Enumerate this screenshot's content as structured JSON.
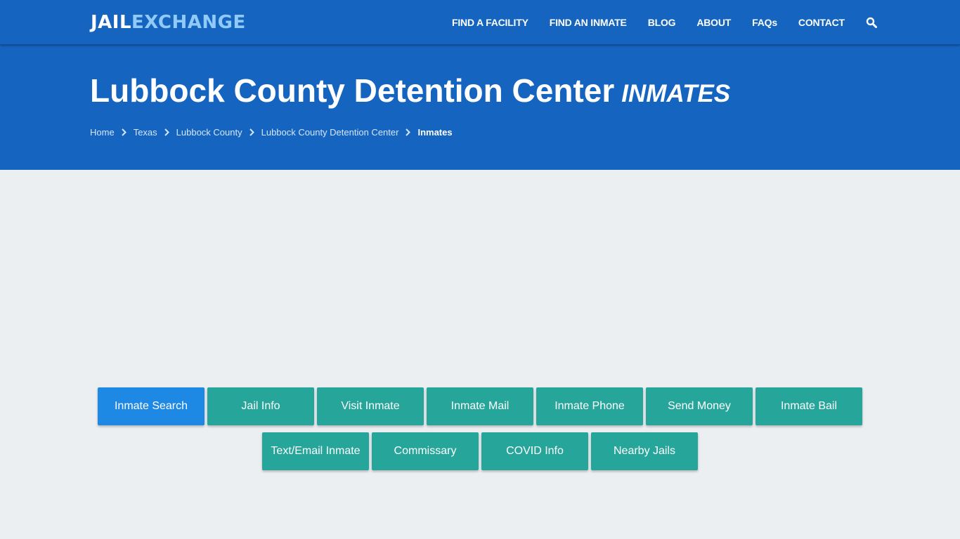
{
  "brand": {
    "logo_part1": "JAIL",
    "logo_part2": "EXCHANGE",
    "colors": {
      "primary": "#1565c0",
      "logo_accent": "#90caf9",
      "button_teal": "#26a69a",
      "button_active": "#1e88e5",
      "page_bg": "#eceff2"
    }
  },
  "nav": {
    "items": [
      {
        "label": "FIND A FACILITY"
      },
      {
        "label": "FIND AN INMATE"
      },
      {
        "label": "BLOG"
      },
      {
        "label": "ABOUT"
      },
      {
        "label": "FAQs"
      },
      {
        "label": "CONTACT"
      }
    ],
    "search_icon": "search-icon"
  },
  "hero": {
    "title": "Lubbock County Detention Center",
    "title_suffix": "INMATES",
    "breadcrumb": [
      {
        "label": "Home"
      },
      {
        "label": "Texas"
      },
      {
        "label": "Lubbock County"
      },
      {
        "label": "Lubbock County Detention Center"
      },
      {
        "label": "Inmates"
      }
    ]
  },
  "buttons": {
    "row1": [
      {
        "label": "Inmate Search",
        "active": true
      },
      {
        "label": "Jail Info"
      },
      {
        "label": "Visit Inmate"
      },
      {
        "label": "Inmate Mail"
      },
      {
        "label": "Inmate Phone"
      },
      {
        "label": "Send Money"
      },
      {
        "label": "Inmate Bail"
      }
    ],
    "row2": [
      {
        "label": "Text/Email Inmate"
      },
      {
        "label": "Commissary"
      },
      {
        "label": "COVID Info"
      },
      {
        "label": "Nearby Jails"
      }
    ]
  }
}
